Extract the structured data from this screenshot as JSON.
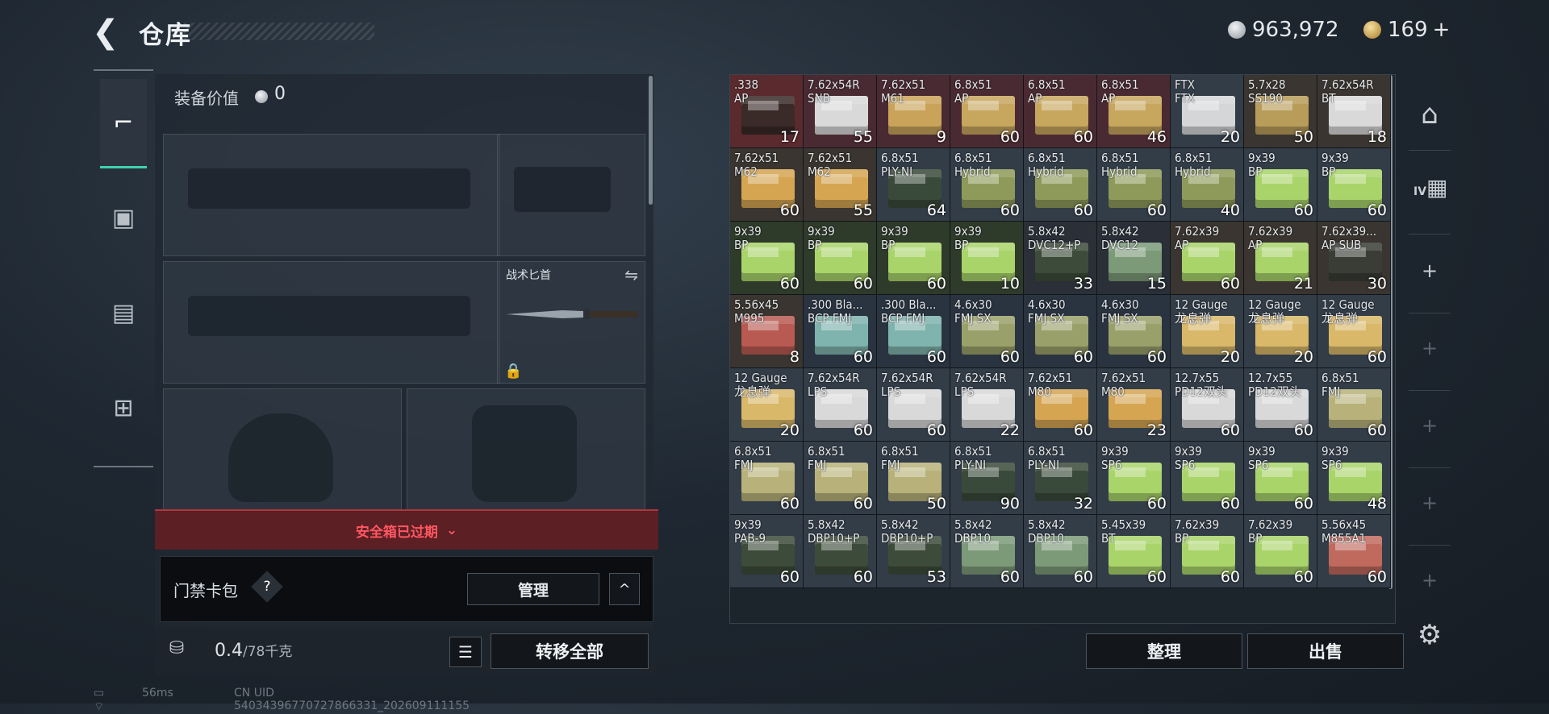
{
  "header": {
    "title": "仓库",
    "currencies": [
      {
        "name": "silver-coin-icon",
        "value": "963,972"
      },
      {
        "name": "gold-coin-icon",
        "value": "169"
      }
    ],
    "add_label": "+"
  },
  "left_tabs": [
    {
      "icon": "pistol-icon",
      "glyph": "⌐",
      "active": true
    },
    {
      "icon": "backpack-icon",
      "glyph": "▣",
      "active": false
    },
    {
      "icon": "vest-icon",
      "glyph": "▤",
      "active": false
    },
    {
      "icon": "toolbox-icon",
      "glyph": "⊞",
      "active": false
    }
  ],
  "equipment": {
    "value_label": "装备价值",
    "value": "0",
    "knife_label": "战术匕首"
  },
  "safe_box": {
    "text": "安全箱已过期",
    "chevron": "⌄"
  },
  "keycard": {
    "label": "门禁卡包",
    "help": "?",
    "manage": "管理",
    "toggle": "^"
  },
  "weight": {
    "current": "0.4",
    "max": "/78千克",
    "kg": "KG",
    "list_icon": "☰",
    "transfer_all": "转移全部"
  },
  "grid_actions": {
    "organize": "整理",
    "sell": "出售"
  },
  "right_side": {
    "plus": "+",
    "gear": "⚙",
    "tier": "IV"
  },
  "footer": {
    "ping": "56ms",
    "uid": "CN UID 54034396770727866331_202609111155"
  },
  "inventory": [
    [
      {
        "name": ".338\nAP",
        "qty": "17",
        "color": "#3a2a28"
      },
      {
        "name": "7.62x54R\nSNB",
        "qty": "55",
        "color": "#d8d9d8"
      },
      {
        "name": "7.62x51\nM61",
        "qty": "9",
        "color": "#c9a35a"
      },
      {
        "name": "6.8x51\nAP",
        "qty": "60",
        "color": "#c7a65e"
      },
      {
        "name": "6.8x51\nAP",
        "qty": "60",
        "color": "#c7a65e"
      },
      {
        "name": "6.8x51\nAP",
        "qty": "46",
        "color": "#c7a65e"
      },
      {
        "name": "FTX\nFTX",
        "qty": "20",
        "color": "#d5d6d8"
      },
      {
        "name": "5.7x28\nSS190",
        "qty": "50",
        "color": "#b89d5a"
      },
      {
        "name": "7.62x54R\nBT",
        "qty": "18",
        "color": "#d8d9d8"
      }
    ],
    [
      {
        "name": "7.62x51\nM62",
        "qty": "60",
        "color": "#d5a552"
      },
      {
        "name": "7.62x51\nM62",
        "qty": "55",
        "color": "#d5a552"
      },
      {
        "name": "6.8x51\nPLY-NI",
        "qty": "64",
        "color": "#3a4a3a"
      },
      {
        "name": "6.8x51\nHybrid",
        "qty": "60",
        "color": "#8e9a5a"
      },
      {
        "name": "6.8x51\nHybrid",
        "qty": "60",
        "color": "#8e9a5a"
      },
      {
        "name": "6.8x51\nHybrid",
        "qty": "60",
        "color": "#8e9a5a"
      },
      {
        "name": "6.8x51\nHybrid",
        "qty": "40",
        "color": "#8e9a5a"
      },
      {
        "name": "9x39\nBP",
        "qty": "60",
        "color": "#a9d46a"
      },
      {
        "name": "9x39\nBP",
        "qty": "60",
        "color": "#a9d46a"
      }
    ],
    [
      {
        "name": "9x39\nBP",
        "qty": "60",
        "color": "#a9d46a"
      },
      {
        "name": "9x39\nBP",
        "qty": "60",
        "color": "#a9d46a"
      },
      {
        "name": "9x39\nBP",
        "qty": "60",
        "color": "#a9d46a"
      },
      {
        "name": "9x39\nBP",
        "qty": "10",
        "color": "#a9d46a"
      },
      {
        "name": "5.8x42\nDVC12+P",
        "qty": "33",
        "color": "#3d4c3a"
      },
      {
        "name": "5.8x42\nDVC12",
        "qty": "15",
        "color": "#7c9a78"
      },
      {
        "name": "7.62x39\nAP",
        "qty": "60",
        "color": "#a9d46a"
      },
      {
        "name": "7.62x39\nAP",
        "qty": "21",
        "color": "#a9d46a"
      },
      {
        "name": "7.62x39...\nAP SUB",
        "qty": "30",
        "color": "#3a3d36"
      }
    ],
    [
      {
        "name": "5.56x45\nM995",
        "qty": "8",
        "color": "#b85a52"
      },
      {
        "name": ".300 Bla...\nBCP FMJ",
        "qty": "60",
        "color": "#7fb3ad"
      },
      {
        "name": ".300 Bla...\nBCP FMJ",
        "qty": "60",
        "color": "#7fb3ad"
      },
      {
        "name": "4.6x30\nFMJ SX",
        "qty": "60",
        "color": "#9aa06a"
      },
      {
        "name": "4.6x30\nFMJ SX",
        "qty": "60",
        "color": "#9aa06a"
      },
      {
        "name": "4.6x30\nFMJ SX",
        "qty": "60",
        "color": "#9aa06a"
      },
      {
        "name": "12 Gauge\n龙息弹",
        "qty": "20",
        "color": "#d9b86a"
      },
      {
        "name": "12 Gauge\n龙息弹",
        "qty": "20",
        "color": "#d9b86a"
      },
      {
        "name": "12 Gauge\n龙息弹",
        "qty": "60",
        "color": "#d9b86a"
      }
    ],
    [
      {
        "name": "12 Gauge\n龙息弹",
        "qty": "20",
        "color": "#d9b86a"
      },
      {
        "name": "7.62x54R\nLPS",
        "qty": "60",
        "color": "#d8d9d8"
      },
      {
        "name": "7.62x54R\nLPS",
        "qty": "60",
        "color": "#d8d9d8"
      },
      {
        "name": "7.62x54R\nLPS",
        "qty": "22",
        "color": "#d8d9d8"
      },
      {
        "name": "7.62x51\nM80",
        "qty": "60",
        "color": "#d5a552"
      },
      {
        "name": "7.62x51\nM80",
        "qty": "23",
        "color": "#d5a552"
      },
      {
        "name": "12.7x55\nPD12双头",
        "qty": "60",
        "color": "#d8d9d8"
      },
      {
        "name": "12.7x55\nPD12双头",
        "qty": "60",
        "color": "#d8d9d8"
      },
      {
        "name": "6.8x51\nFMJ",
        "qty": "60",
        "color": "#b8b27a"
      }
    ],
    [
      {
        "name": "6.8x51\nFMJ",
        "qty": "60",
        "color": "#b8b27a"
      },
      {
        "name": "6.8x51\nFMJ",
        "qty": "60",
        "color": "#b8b27a"
      },
      {
        "name": "6.8x51\nFMJ",
        "qty": "50",
        "color": "#b8b27a"
      },
      {
        "name": "6.8x51\nPLY-NI",
        "qty": "90",
        "color": "#3a4a3a"
      },
      {
        "name": "6.8x51\nPLY-NI",
        "qty": "32",
        "color": "#3a4a3a"
      },
      {
        "name": "9x39\nSP6",
        "qty": "60",
        "color": "#a9d46a"
      },
      {
        "name": "9x39\nSP6",
        "qty": "60",
        "color": "#a9d46a"
      },
      {
        "name": "9x39\nSP6",
        "qty": "60",
        "color": "#a9d46a"
      },
      {
        "name": "9x39\nSP6",
        "qty": "48",
        "color": "#a9d46a"
      }
    ],
    [
      {
        "name": "9x39\nPAB-9",
        "qty": "60",
        "color": "#3d4c3a"
      },
      {
        "name": "5.8x42\nDBP10+P",
        "qty": "60",
        "color": "#3d4c3a"
      },
      {
        "name": "5.8x42\nDBP10+P",
        "qty": "53",
        "color": "#3d4c3a"
      },
      {
        "name": "5.8x42\nDBP10",
        "qty": "60",
        "color": "#7c9a78"
      },
      {
        "name": "5.8x42\nDBP10",
        "qty": "60",
        "color": "#7c9a78"
      },
      {
        "name": "5.45x39\nBT",
        "qty": "60",
        "color": "#a9d46a"
      },
      {
        "name": "7.62x39\nBP",
        "qty": "60",
        "color": "#a9d46a"
      },
      {
        "name": "7.62x39\nBP",
        "qty": "60",
        "color": "#a9d46a"
      },
      {
        "name": "5.56x45\nM855A1",
        "qty": "60",
        "color": "#c06a5e"
      }
    ]
  ],
  "cell_tints": [
    [
      "#5a2a2e",
      "#4a2a32",
      "#4a2a32",
      "#4a2a32",
      "#4a2a32",
      "#4a2a32",
      "#333d48",
      "#3a3530",
      "#3a3530"
    ],
    [
      "#3a3530",
      "#3a3530",
      "#333d48",
      "#333d48",
      "#333d48",
      "#333d48",
      "#333d48",
      "#333d48",
      "#333d48"
    ],
    [
      "#2e3a2a",
      "#2e3a2a",
      "#2e3a2a",
      "#2e3a2a",
      "#2a2f38",
      "#2a2f38",
      "#3a3530",
      "#3a3530",
      "#3a3530"
    ],
    [
      "#3a3530",
      "#2a3440",
      "#2a3440",
      "#2a3440",
      "#2a3440",
      "#2a3440",
      "#333d48",
      "#333d48",
      "#333d48"
    ],
    [
      "#333d48",
      "#333d48",
      "#333d48",
      "#333d48",
      "#333d48",
      "#333d48",
      "#333d48",
      "#333d48",
      "#333d48"
    ],
    [
      "#333d48",
      "#333d48",
      "#333d48",
      "#333d48",
      "#333d48",
      "#333d48",
      "#333d48",
      "#333d48",
      "#333d48"
    ],
    [
      "#333d48",
      "#333d48",
      "#333d48",
      "#333d48",
      "#333d48",
      "#333d48",
      "#333d48",
      "#333d48",
      "#333d48"
    ]
  ]
}
